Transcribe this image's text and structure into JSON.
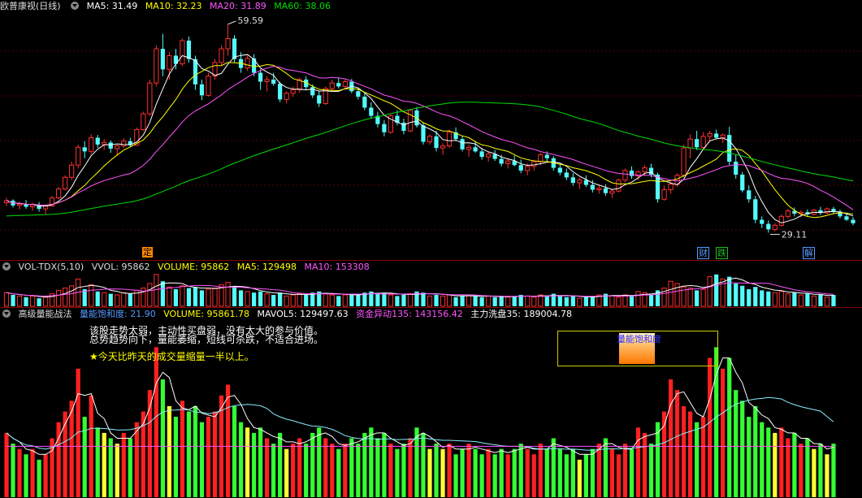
{
  "colors": {
    "up": "#ff3030",
    "down": "#54fcfc",
    "ma5": "#ffffff",
    "ma10": "#ffff00",
    "ma20": "#ff55ff",
    "ma60": "#00dd00",
    "vol_ma5": "#ffffff",
    "vol_ma10": "#ff55ff",
    "green_bar": "#33ff33",
    "yellow_bar": "#ffff33",
    "red_bar": "#ff2020",
    "light_blue_line": "#88eeff"
  },
  "price_pane": {
    "title": "欧普康视(日线)",
    "ma5": "MA5: 31.49",
    "ma10": "MA10: 32.23",
    "ma20": "MA20: 31.89",
    "ma60": "MA60: 38.06",
    "high_label": "59.59",
    "low_label": "29.11",
    "markers": [
      {
        "text": "定",
        "color": "#ff8800"
      },
      {
        "text": "财",
        "color": "#5599ff"
      },
      {
        "text": "跌",
        "color": "#22bb22"
      },
      {
        "text": "解",
        "color": "#5599ff"
      }
    ]
  },
  "volume_pane": {
    "title": "VOL-TDX(5,10)",
    "vvol": "VVOL: 95862",
    "volume": "VOLUME: 95862",
    "ma5": "MA5: 129498",
    "ma10": "MA10: 153308"
  },
  "indicator_pane": {
    "title": "高级量能战法",
    "saturation": "量能饱和度: 21.90",
    "volume": "VOLUME: 95861.78",
    "mavol5": "MAVOL5: 129497.63",
    "fund_move": "资金异动135: 143156.42",
    "wash": "主力洗盘35: 189004.78",
    "line1": "该股走势太弱，主动性买盘弱，没有太大的参与价值。",
    "line2": "总势趋势向下，量能萎缩，短线可杀跌，不适合进场。",
    "line3": "★今天比昨天的成交量缩量一半以上。",
    "box_label": "量能饱和度"
  },
  "chart_data": [
    {
      "type": "candlestick",
      "pane": "price",
      "note": "daily candles, approximate OHLC read from chart",
      "ohlc": [
        [
          33.5,
          34.2,
          33.0,
          33.8
        ],
        [
          33.8,
          34.0,
          32.8,
          33.1
        ],
        [
          33.1,
          33.6,
          32.5,
          33.3
        ],
        [
          33.3,
          33.9,
          32.6,
          32.9
        ],
        [
          32.9,
          33.5,
          32.3,
          33.2
        ],
        [
          33.2,
          33.6,
          32.2,
          32.6
        ],
        [
          32.6,
          33.2,
          31.8,
          33.0
        ],
        [
          33.0,
          34.5,
          32.9,
          34.2
        ],
        [
          34.2,
          35.8,
          34.0,
          35.5
        ],
        [
          35.5,
          37.5,
          35.3,
          37.2
        ],
        [
          37.2,
          39.5,
          36.8,
          39.0
        ],
        [
          39.0,
          42.0,
          38.5,
          41.6
        ],
        [
          41.6,
          42.5,
          40.0,
          41.0
        ],
        [
          41.0,
          43.5,
          40.6,
          43.0
        ],
        [
          43.0,
          43.4,
          41.5,
          42.0
        ],
        [
          42.0,
          42.8,
          41.2,
          42.3
        ],
        [
          42.3,
          42.6,
          40.8,
          41.4
        ],
        [
          41.4,
          42.0,
          40.5,
          41.8
        ],
        [
          41.8,
          42.9,
          41.5,
          42.5
        ],
        [
          42.5,
          43.0,
          41.6,
          41.9
        ],
        [
          41.9,
          44.5,
          41.8,
          44.2
        ],
        [
          44.2,
          46.8,
          44.0,
          46.5
        ],
        [
          46.5,
          51.5,
          46.2,
          51.0
        ],
        [
          51.0,
          56.5,
          50.5,
          56.0
        ],
        [
          56.0,
          58.2,
          52.0,
          53.0
        ],
        [
          53.0,
          55.5,
          51.5,
          55.0
        ],
        [
          55.0,
          56.0,
          53.0,
          53.8
        ],
        [
          53.8,
          57.5,
          53.5,
          57.2
        ],
        [
          57.2,
          57.8,
          54.0,
          54.5
        ],
        [
          54.5,
          55.0,
          50.0,
          50.8
        ],
        [
          50.8,
          51.5,
          48.5,
          49.2
        ],
        [
          49.2,
          52.5,
          49.0,
          52.0
        ],
        [
          52.0,
          54.5,
          51.5,
          54.0
        ],
        [
          54.0,
          56.5,
          53.5,
          56.0
        ],
        [
          56.0,
          59.59,
          55.0,
          57.5
        ],
        [
          57.5,
          58.0,
          54.0,
          54.5
        ],
        [
          54.5,
          55.5,
          52.5,
          53.2
        ],
        [
          53.2,
          55.0,
          52.8,
          54.6
        ],
        [
          54.6,
          55.2,
          52.0,
          52.5
        ],
        [
          52.5,
          53.0,
          50.0,
          51.2
        ],
        [
          51.2,
          52.0,
          49.8,
          51.5
        ],
        [
          51.5,
          52.5,
          50.6,
          50.9
        ],
        [
          50.9,
          51.2,
          48.2,
          48.6
        ],
        [
          48.6,
          49.8,
          48.0,
          49.5
        ],
        [
          49.5,
          50.5,
          49.0,
          50.0
        ],
        [
          50.0,
          51.8,
          49.6,
          51.5
        ],
        [
          51.5,
          52.0,
          50.0,
          50.4
        ],
        [
          50.4,
          50.8,
          48.8,
          49.2
        ],
        [
          49.2,
          49.8,
          47.5,
          48.0
        ],
        [
          48.0,
          50.5,
          47.8,
          50.2
        ],
        [
          50.2,
          51.5,
          49.8,
          51.0
        ],
        [
          51.0,
          51.8,
          50.2,
          50.5
        ],
        [
          50.5,
          51.5,
          50.0,
          51.2
        ],
        [
          51.2,
          51.6,
          49.5,
          49.8
        ],
        [
          49.8,
          50.3,
          48.6,
          49.0
        ],
        [
          49.0,
          49.5,
          47.0,
          47.4
        ],
        [
          47.4,
          48.2,
          45.8,
          46.2
        ],
        [
          46.2,
          46.8,
          44.5,
          45.0
        ],
        [
          45.0,
          45.6,
          43.2,
          43.8
        ],
        [
          43.8,
          46.5,
          43.6,
          46.2
        ],
        [
          46.2,
          47.0,
          44.8,
          45.2
        ],
        [
          45.2,
          45.8,
          43.5,
          44.0
        ],
        [
          44.0,
          47.2,
          43.8,
          47.0
        ],
        [
          47.0,
          47.5,
          44.5,
          44.8
        ],
        [
          44.8,
          45.2,
          42.0,
          42.4
        ],
        [
          42.4,
          43.5,
          42.0,
          43.2
        ],
        [
          43.2,
          44.0,
          41.0,
          41.5
        ],
        [
          41.5,
          42.2,
          40.5,
          41.8
        ],
        [
          41.8,
          44.2,
          41.5,
          43.8
        ],
        [
          43.8,
          44.5,
          42.5,
          42.8
        ],
        [
          42.8,
          43.2,
          41.0,
          41.3
        ],
        [
          41.3,
          42.0,
          40.2,
          41.6
        ],
        [
          41.6,
          42.5,
          40.8,
          41.0
        ],
        [
          41.0,
          41.5,
          39.8,
          40.2
        ],
        [
          40.2,
          41.0,
          39.5,
          40.6
        ],
        [
          40.6,
          41.2,
          39.6,
          39.9
        ],
        [
          39.9,
          40.5,
          38.8,
          39.2
        ],
        [
          39.2,
          40.0,
          38.5,
          39.6
        ],
        [
          39.6,
          40.4,
          38.8,
          39.0
        ],
        [
          39.0,
          39.8,
          37.8,
          38.2
        ],
        [
          38.2,
          39.2,
          37.5,
          38.8
        ],
        [
          38.8,
          39.8,
          38.2,
          39.5
        ],
        [
          39.5,
          40.8,
          39.0,
          40.5
        ],
        [
          40.5,
          41.0,
          39.6,
          40.0
        ],
        [
          40.0,
          40.3,
          38.2,
          38.6
        ],
        [
          38.6,
          39.2,
          37.5,
          37.9
        ],
        [
          37.9,
          38.5,
          36.8,
          37.2
        ],
        [
          37.2,
          37.8,
          36.0,
          36.4
        ],
        [
          36.4,
          37.2,
          35.5,
          36.8
        ],
        [
          36.8,
          37.5,
          35.8,
          36.1
        ],
        [
          36.1,
          36.8,
          35.0,
          35.4
        ],
        [
          35.4,
          36.0,
          34.8,
          35.6
        ],
        [
          35.6,
          36.2,
          34.5,
          34.9
        ],
        [
          34.9,
          35.5,
          34.2,
          35.2
        ],
        [
          35.2,
          37.0,
          35.0,
          36.8
        ],
        [
          36.8,
          38.5,
          36.5,
          38.2
        ],
        [
          38.2,
          38.8,
          37.0,
          37.4
        ],
        [
          37.4,
          38.2,
          36.8,
          38.0
        ],
        [
          38.0,
          39.0,
          37.4,
          38.6
        ],
        [
          38.6,
          39.2,
          37.2,
          37.6
        ],
        [
          37.6,
          37.9,
          33.5,
          34.0
        ],
        [
          34.0,
          36.0,
          33.8,
          35.4
        ],
        [
          35.4,
          36.6,
          34.8,
          36.2
        ],
        [
          36.2,
          37.8,
          35.8,
          37.5
        ],
        [
          37.5,
          42.0,
          37.2,
          41.5
        ],
        [
          41.5,
          43.5,
          40.0,
          42.8
        ],
        [
          42.8,
          44.0,
          41.2,
          41.6
        ],
        [
          41.6,
          43.8,
          41.4,
          43.2
        ],
        [
          43.2,
          44.0,
          42.5,
          43.6
        ],
        [
          43.6,
          44.2,
          42.8,
          43.0
        ],
        [
          43.0,
          43.6,
          42.2,
          43.4
        ],
        [
          43.4,
          44.6,
          39.0,
          39.5
        ],
        [
          39.5,
          40.5,
          37.0,
          37.6
        ],
        [
          37.6,
          38.0,
          35.0,
          35.3
        ],
        [
          35.3,
          36.0,
          33.5,
          34.0
        ],
        [
          34.0,
          34.5,
          30.5,
          31.0
        ],
        [
          31.0,
          31.5,
          29.8,
          30.4
        ],
        [
          30.4,
          30.9,
          29.11,
          29.6
        ],
        [
          29.6,
          30.5,
          29.3,
          30.2
        ],
        [
          30.2,
          31.8,
          30.0,
          31.5
        ],
        [
          31.5,
          32.6,
          31.2,
          32.3
        ],
        [
          32.3,
          32.8,
          31.5,
          31.9
        ],
        [
          31.9,
          32.4,
          31.4,
          32.1
        ],
        [
          32.1,
          32.5,
          31.5,
          31.8
        ],
        [
          31.8,
          32.6,
          31.6,
          32.4
        ],
        [
          32.4,
          32.9,
          31.7,
          32.0
        ],
        [
          32.0,
          32.8,
          31.8,
          32.6
        ],
        [
          32.6,
          32.9,
          31.9,
          32.2
        ],
        [
          32.2,
          32.5,
          31.2,
          31.5
        ],
        [
          31.5,
          32.0,
          30.8,
          31.0
        ],
        [
          31.0,
          31.4,
          30.2,
          30.5
        ]
      ],
      "ma_lines": {
        "MA5": 31.49,
        "MA10": 32.23,
        "MA20": 31.89,
        "MA60": 38.06
      }
    },
    {
      "type": "bar",
      "pane": "volume",
      "values": [
        1.2,
        1.0,
        0.9,
        0.8,
        0.9,
        0.7,
        0.8,
        1.1,
        1.4,
        1.6,
        1.8,
        2.4,
        1.5,
        1.9,
        1.3,
        1.2,
        1.1,
        1.0,
        1.2,
        1.1,
        1.4,
        1.6,
        2.0,
        2.8,
        2.2,
        1.7,
        1.5,
        1.8,
        1.6,
        1.7,
        1.4,
        1.5,
        1.6,
        1.9,
        2.1,
        1.7,
        1.4,
        1.3,
        1.2,
        1.3,
        1.1,
        1.0,
        1.2,
        0.9,
        1.0,
        1.1,
        1.0,
        1.2,
        1.3,
        1.1,
        1.0,
        0.9,
        1.0,
        1.1,
        1.0,
        1.2,
        1.3,
        1.1,
        1.2,
        1.0,
        0.9,
        1.0,
        1.1,
        1.3,
        1.2,
        0.9,
        1.0,
        0.9,
        1.0,
        0.8,
        0.9,
        1.0,
        0.9,
        0.8,
        0.9,
        0.8,
        0.9,
        0.8,
        0.9,
        1.0,
        0.9,
        0.8,
        1.0,
        0.9,
        1.1,
        0.9,
        0.8,
        0.9,
        0.7,
        0.8,
        0.9,
        1.0,
        1.1,
        0.9,
        0.8,
        1.0,
        0.9,
        1.3,
        1.2,
        1.0,
        1.4,
        1.6,
        2.2,
        2.0,
        1.7,
        1.6,
        1.4,
        1.5,
        2.6,
        2.8,
        2.4,
        2.6,
        2.0,
        1.8,
        1.5,
        1.7,
        1.4,
        1.3,
        1.2,
        1.3,
        1.1,
        1.2,
        1.0,
        1.1,
        0.9,
        1.0,
        0.8,
        1.0
      ],
      "ylabel": "VOLUME"
    }
  ]
}
